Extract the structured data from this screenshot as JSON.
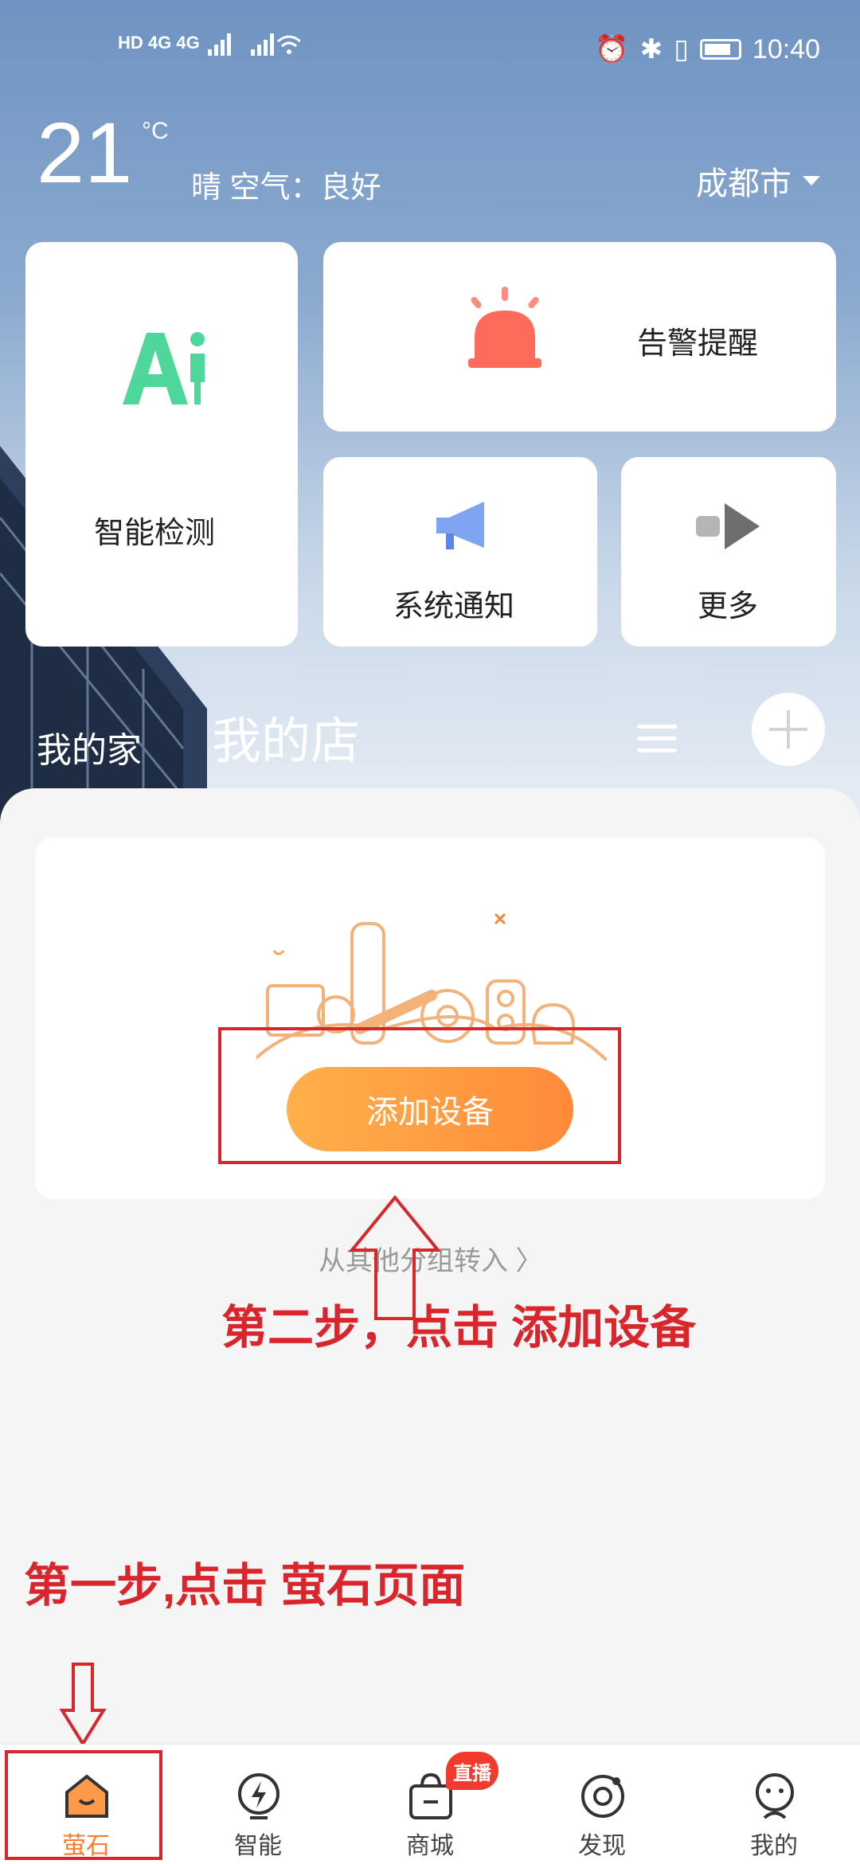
{
  "status_bar": {
    "network_left": "HD 4G 4G",
    "time": "10:40"
  },
  "weather": {
    "temp": "21",
    "unit": "°C",
    "desc": "晴 空气：良好",
    "city": "成都市"
  },
  "cards": {
    "ai_detect": "智能检测",
    "alarm": "告警提醒",
    "notice": "系统通知",
    "more": "更多"
  },
  "group_tabs": {
    "home": "我的家",
    "shop": "我的店"
  },
  "main": {
    "add_device": "添加设备",
    "transfer": "从其他分组转入 〉"
  },
  "annotations": {
    "step2": "第二步，点击 添加设备",
    "step1": "第一步,点击 萤石页面"
  },
  "bottom_nav": [
    {
      "label": "萤石",
      "icon": "home-icon",
      "color": "#ff7a2e"
    },
    {
      "label": "智能",
      "icon": "smart-bolt-icon"
    },
    {
      "label": "商城",
      "icon": "shop-bag-icon",
      "badge": "直播"
    },
    {
      "label": "发现",
      "icon": "discover-icon"
    },
    {
      "label": "我的",
      "icon": "profile-icon"
    }
  ],
  "colors": {
    "accent": "#ff8a3a",
    "annotation_red": "#d9262c",
    "ai_green": "#4fd79b",
    "alarm_red": "#ff6b5b"
  }
}
